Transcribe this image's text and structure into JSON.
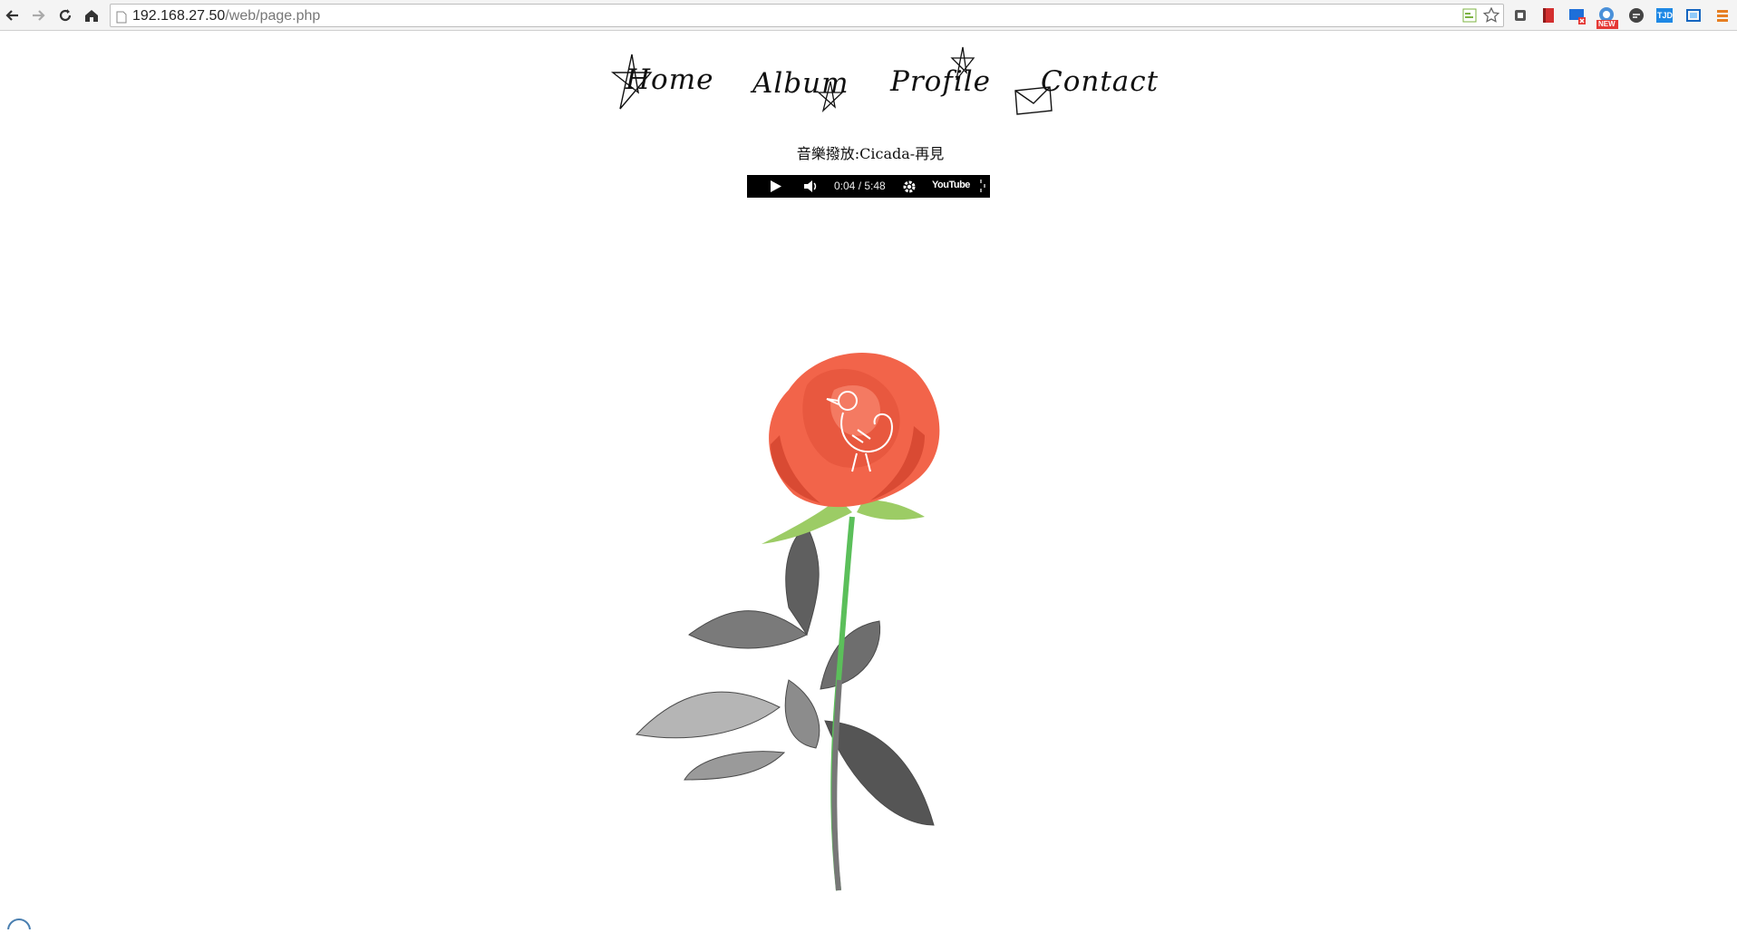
{
  "browser": {
    "url_host": "192.168.27.50",
    "url_path": "/web/page.php",
    "extensions": [
      {
        "name": "rss-icon",
        "color": "#7cb342"
      },
      {
        "name": "star-icon",
        "color": "#666666"
      },
      {
        "name": "pocket-icon",
        "color": "#555555"
      },
      {
        "name": "bookmark-red-icon",
        "color": "#d32f2f"
      },
      {
        "name": "screen-icon",
        "color": "#1e6fd9"
      },
      {
        "name": "new-badge-icon",
        "color": "#e53935"
      },
      {
        "name": "chat-icon",
        "color": "#444444"
      },
      {
        "name": "tjd-icon",
        "color": "#1e88e5"
      },
      {
        "name": "window-icon",
        "color": "#1565c0"
      },
      {
        "name": "menu-icon",
        "color": "#e67e22"
      }
    ],
    "new_badge": "NEW",
    "tjd_label": "TJD"
  },
  "nav": {
    "home": "Home",
    "album": "Album",
    "profile": "Profile",
    "contact": "Contact"
  },
  "music": {
    "label": "音樂撥放:Cicada-再見"
  },
  "player": {
    "time": "0:04 / 5:48",
    "brand": "YouTube"
  },
  "colors": {
    "petal": "#f2644a",
    "petal_dark": "#d94a33",
    "stem": "#5bbf5a",
    "leaf_gray": "#6b6b6b"
  }
}
